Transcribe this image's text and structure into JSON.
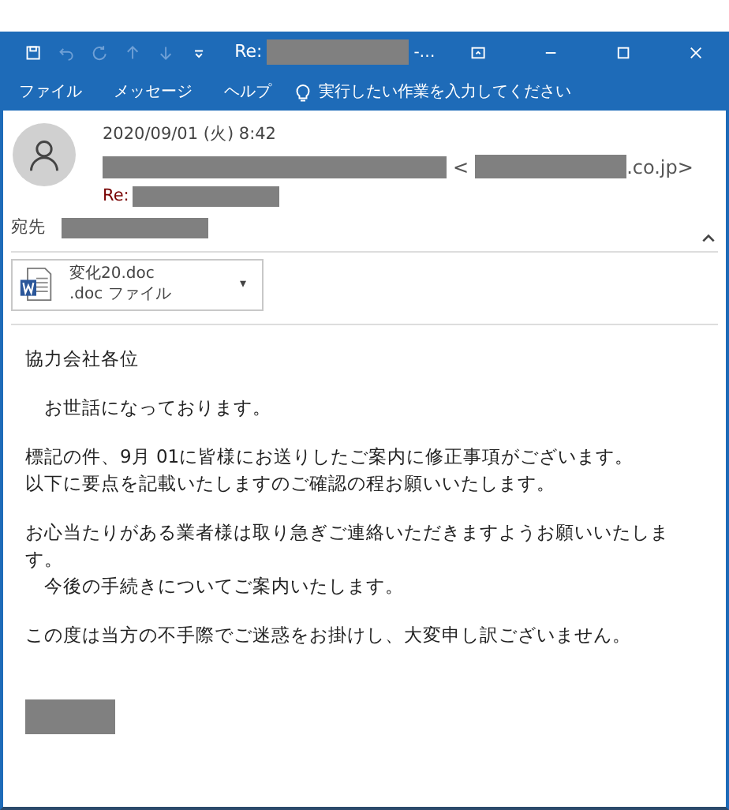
{
  "window": {
    "title_prefix": "Re:",
    "title_suffix": "-…"
  },
  "menu": [
    {
      "label": "ファイル",
      "selected": false
    },
    {
      "label": "メッセージ",
      "selected": false
    },
    {
      "label": "ヘルプ",
      "selected": false
    }
  ],
  "tell_me": {
    "placeholder": "実行したい作業を入力してください"
  },
  "header": {
    "date": "2020/09/01 (火) 8:42",
    "from_open": "<",
    "from_close": ".co.jp>",
    "subject_prefix": "Re:",
    "to_label": "宛先"
  },
  "attachment": {
    "name": "変化20.doc",
    "type": ".doc ファイル",
    "caret": "▾"
  },
  "body": [
    {
      "lines": [
        "協力会社各位"
      ]
    },
    {
      "lines": [
        "　お世話になっております。"
      ]
    },
    {
      "lines": [
        "標記の件、9月 01に皆様にお送りしたご案内に修正事項がございます。",
        "以下に要点を記載いたしますのご確認の程お願いいたします。"
      ]
    },
    {
      "lines": [
        "お心当たりがある業者様は取り急ぎご連絡いただきますようお願いいたします。",
        "　今後の手続きについてご案内いたします。"
      ]
    },
    {
      "lines": [
        "この度は当方の不手際でご迷惑をお掛けし、大変申し訳ございません。"
      ]
    }
  ]
}
